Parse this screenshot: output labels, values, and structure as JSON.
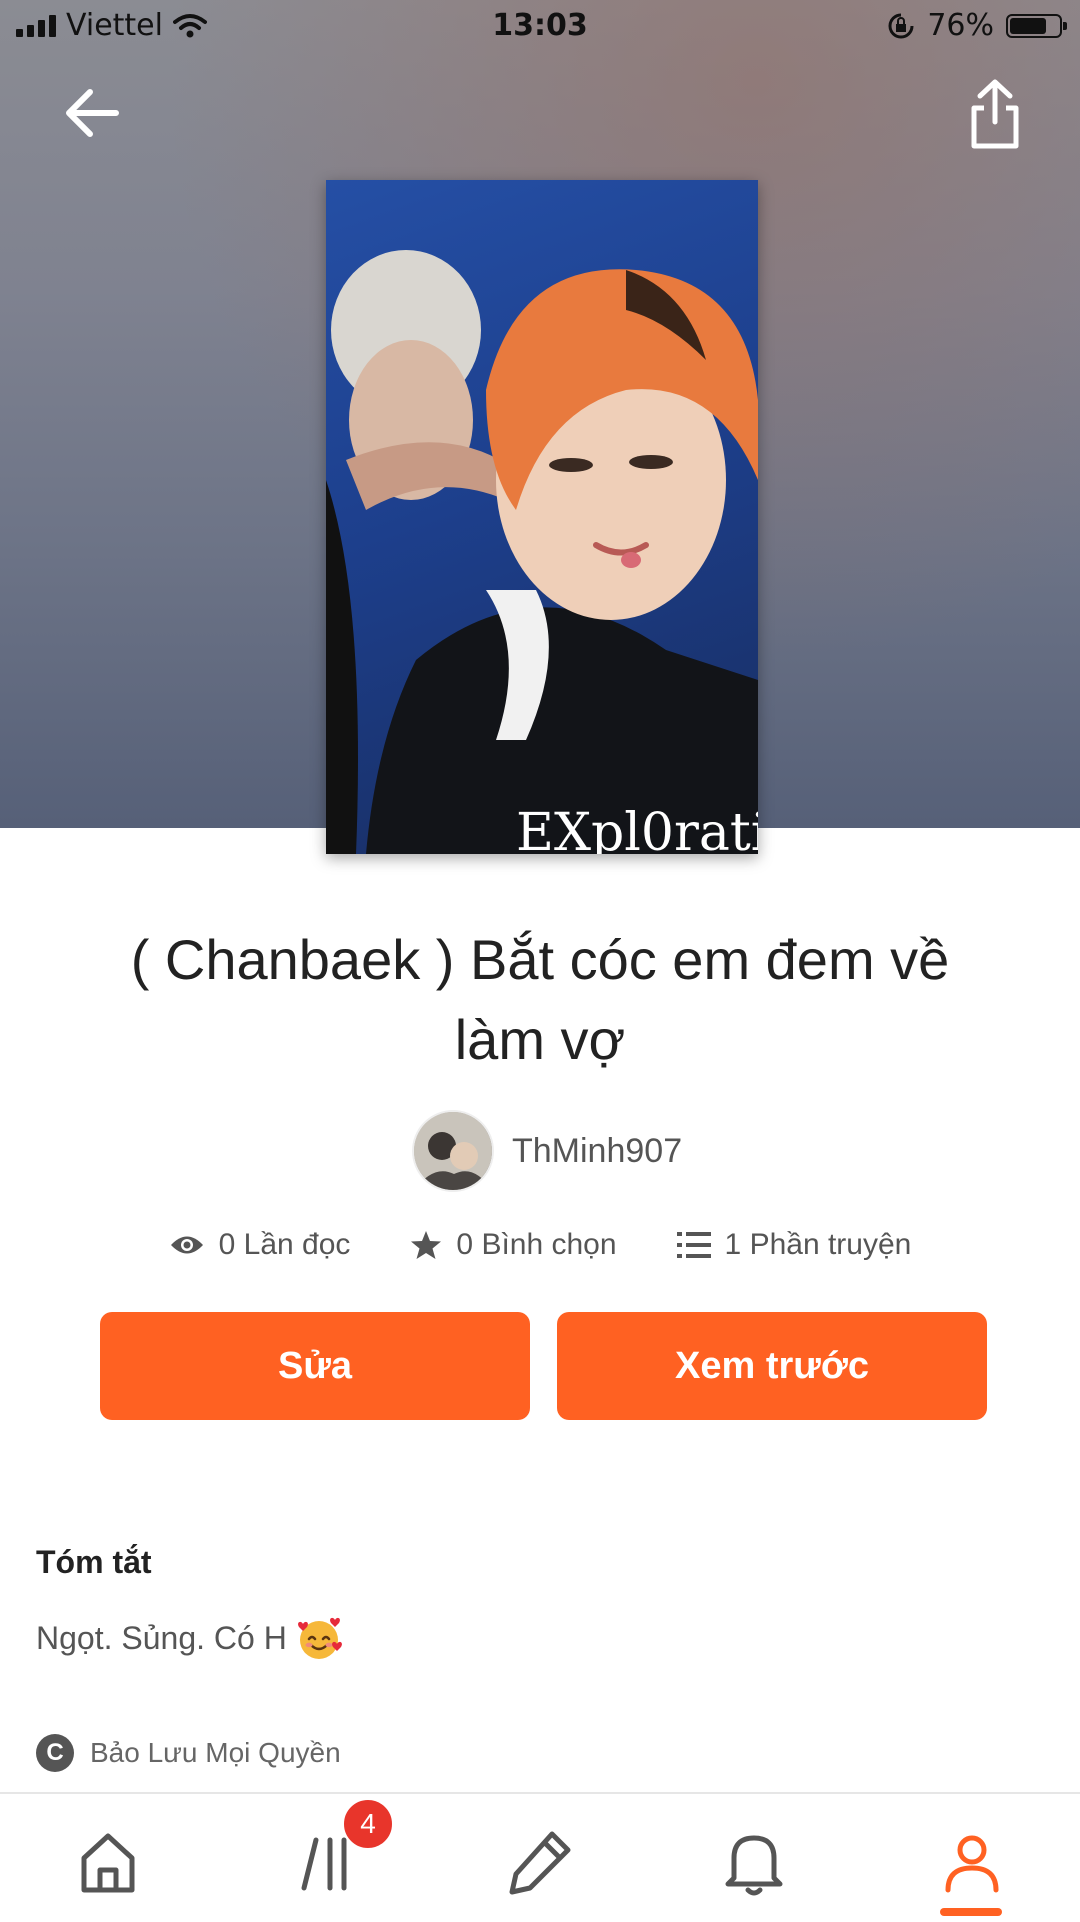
{
  "status_bar": {
    "carrier": "Viettel",
    "time": "13:03",
    "battery": "76%",
    "battery_level": 0.76
  },
  "story": {
    "title": "( Chanbaek ) Bắt cóc em đem về làm vợ",
    "author": "ThMinh907",
    "stats": {
      "reads": "0 Lần đọc",
      "votes": "0 Bình chọn",
      "parts": "1 Phần truyện"
    },
    "summary_heading": "Tóm tắt",
    "summary_text": "Ngọt. Sủng. Có H",
    "copyright": "Bảo Lưu Mọi Quyền",
    "cover_text": "EXpl0rati"
  },
  "actions": {
    "edit_label": "Sửa",
    "preview_label": "Xem trước"
  },
  "colors": {
    "accent": "#ff6122",
    "badge": "#e8352b"
  },
  "tabbar": {
    "items": [
      {
        "icon": "home-icon"
      },
      {
        "icon": "library-icon",
        "badge": "4"
      },
      {
        "icon": "pencil-icon"
      },
      {
        "icon": "bell-icon"
      },
      {
        "icon": "profile-icon",
        "active": true
      }
    ]
  }
}
